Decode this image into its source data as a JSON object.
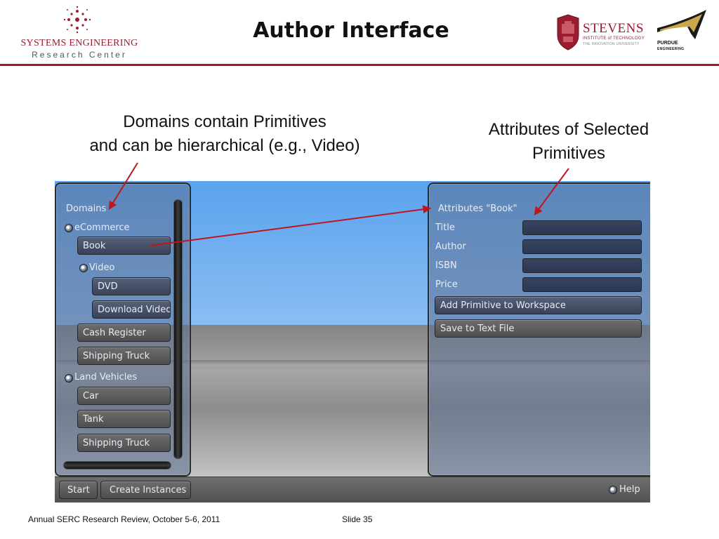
{
  "header": {
    "title": "Author Interface",
    "serc_logo": {
      "line1": "SYSTEMS ENGINEERING",
      "line2": "Research Center"
    },
    "stevens_logo": {
      "name": "STEVENS",
      "sub1": "INSTITUTE of TECHNOLOGY",
      "sub2": "THE INNOVATION UNIVERSITY"
    },
    "purdue_logo": {
      "line1": "PURDUE",
      "line2": "ENGINEERING"
    },
    "brand_color": "#9b1b30"
  },
  "callouts": {
    "left_line1": "Domains contain Primitives",
    "left_line2": "and can be hierarchical (e.g., Video)",
    "right_line1": "Attributes of Selected",
    "right_line2": "Primitives",
    "arrow_color": "#c0141e"
  },
  "app": {
    "domains_panel": {
      "title": "Domains",
      "groups": [
        {
          "label": "eCommerce"
        },
        {
          "label": "Video"
        },
        {
          "label": "Land Vehicles"
        }
      ],
      "items": [
        "Book",
        "DVD",
        "Download Video",
        "Cash Register",
        "Shipping Truck",
        "Car",
        "Tank",
        "Shipping Truck"
      ]
    },
    "attributes_panel": {
      "title": "Attributes \"Book\"",
      "fields": [
        {
          "label": "Title",
          "value": ""
        },
        {
          "label": "Author",
          "value": ""
        },
        {
          "label": "ISBN",
          "value": ""
        },
        {
          "label": "Price",
          "value": ""
        }
      ],
      "add_button": "Add Primitive to Workspace",
      "save_button": "Save to Text File"
    },
    "bottom_bar": {
      "start": "Start",
      "create_instances": "Create Instances",
      "help": "Help"
    }
  },
  "footer": {
    "left": "Annual SERC Research Review, October 5-6, 2011",
    "right": "Slide 35"
  }
}
